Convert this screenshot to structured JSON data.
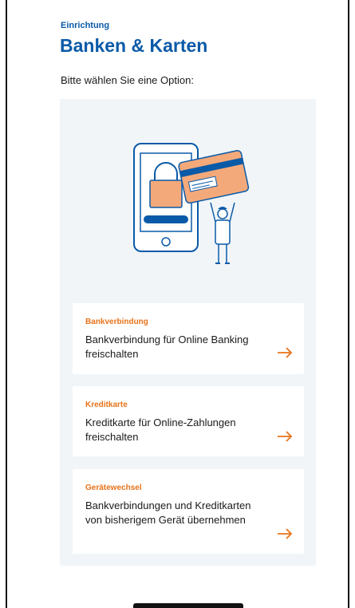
{
  "header": {
    "overline": "Einrichtung",
    "title": "Banken & Karten",
    "prompt": "Bitte wählen Sie eine Option:"
  },
  "options": [
    {
      "kicker": "Bankverbindung",
      "description": "Bankverbindung für Online Banking freischalten",
      "icon": "arrow-right-icon"
    },
    {
      "kicker": "Kreditkarte",
      "description": "Kreditkarte für Online-Zahlungen freischalten",
      "icon": "arrow-right-icon"
    },
    {
      "kicker": "Gerätewechsel",
      "description": "Bankverbindungen und Kreditkarten von bisherigem Gerät übernehmen",
      "icon": "arrow-right-icon"
    }
  ],
  "colors": {
    "primary": "#0a5aa8",
    "accent": "#e8731a",
    "panel": "#f1f5f8"
  }
}
